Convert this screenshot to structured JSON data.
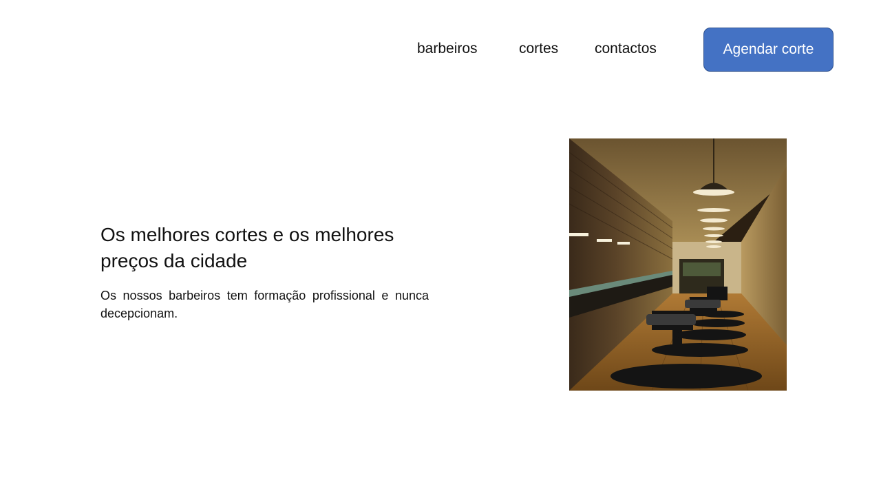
{
  "nav": {
    "links": [
      {
        "label": "barbeiros"
      },
      {
        "label": "cortes"
      },
      {
        "label": "contactos"
      }
    ],
    "cta_label": "Agendar corte"
  },
  "hero": {
    "title": "Os melhores cortes e os melhores preços da cidade",
    "text": "Os nossos barbeiros tem formação profissional e nunca decepcionam.",
    "image": "barbershop-interior-photo"
  },
  "colors": {
    "accent": "#4472c4",
    "accent_border": "#2f528f",
    "text": "#111111",
    "background": "#ffffff"
  }
}
